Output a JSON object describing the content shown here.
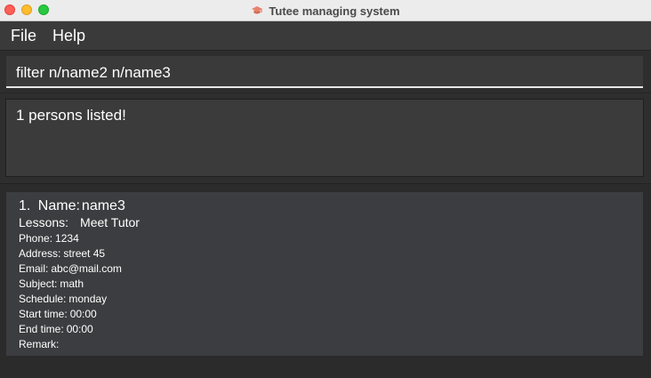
{
  "window": {
    "title": "Tutee managing system",
    "app_icon": "graduation-cap-icon"
  },
  "menu": {
    "file": "File",
    "help": "Help"
  },
  "command": {
    "value": "filter n/name2 n/name3"
  },
  "result": {
    "message": "1 persons listed!"
  },
  "persons": [
    {
      "index": "1.",
      "name_label": "Name:",
      "name": "name3",
      "lessons_label": "Lessons:",
      "lessons": "Meet Tutor",
      "details": [
        {
          "label": "Phone:",
          "value": "1234"
        },
        {
          "label": "Address:",
          "value": "street 45"
        },
        {
          "label": "Email:",
          "value": "abc@mail.com"
        },
        {
          "label": "Subject:",
          "value": "math"
        },
        {
          "label": "Schedule:",
          "value": "monday"
        },
        {
          "label": "Start time:",
          "value": "00:00"
        },
        {
          "label": "End time:",
          "value": "00:00"
        },
        {
          "label": "Remark:",
          "value": ""
        }
      ]
    }
  ]
}
